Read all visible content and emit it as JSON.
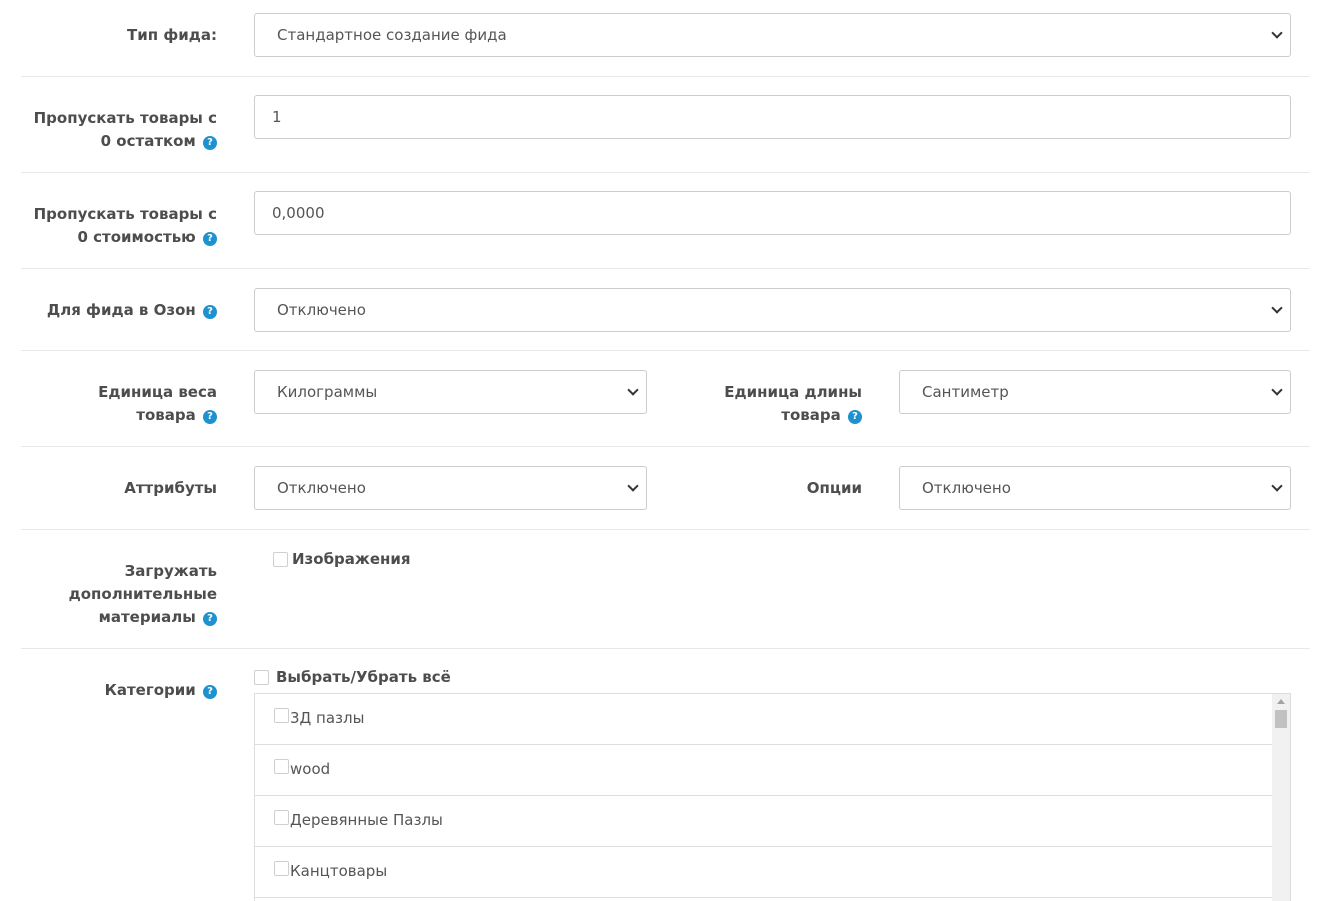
{
  "feed_type": {
    "label": "Тип фида:",
    "value": "Стандартное создание фида"
  },
  "skip_zero_stock": {
    "label_line1": "Пропускать товары с",
    "label_line2": "0 остатком",
    "value": "1"
  },
  "skip_zero_price": {
    "label_line1": "Пропускать товары с",
    "label_line2": "0 стоимостью",
    "value": "0,0000"
  },
  "ozon_feed": {
    "label": "Для фида в Озон",
    "value": "Отключено"
  },
  "weight_unit": {
    "label_line1": "Единица веса",
    "label_line2": "товара",
    "value": "Килограммы"
  },
  "length_unit": {
    "label_line1": "Единица длины",
    "label_line2": "товара",
    "value": "Сантиметр"
  },
  "attributes": {
    "label": "Аттрибуты",
    "value": "Отключено"
  },
  "options": {
    "label": "Опции",
    "value": "Отключено"
  },
  "extra_materials": {
    "label_line1": "Загружать",
    "label_line2": "дополнительные",
    "label_line3": "материалы",
    "images_label": "Изображения"
  },
  "categories": {
    "label": "Категории",
    "select_all_label": "Выбрать/Убрать всё",
    "items": [
      {
        "label": "3Д пазлы"
      },
      {
        "label": "wood"
      },
      {
        "label": "Деревянные Пазлы"
      },
      {
        "label": "Канцтовары"
      }
    ]
  },
  "help_icon_glyph": "?"
}
